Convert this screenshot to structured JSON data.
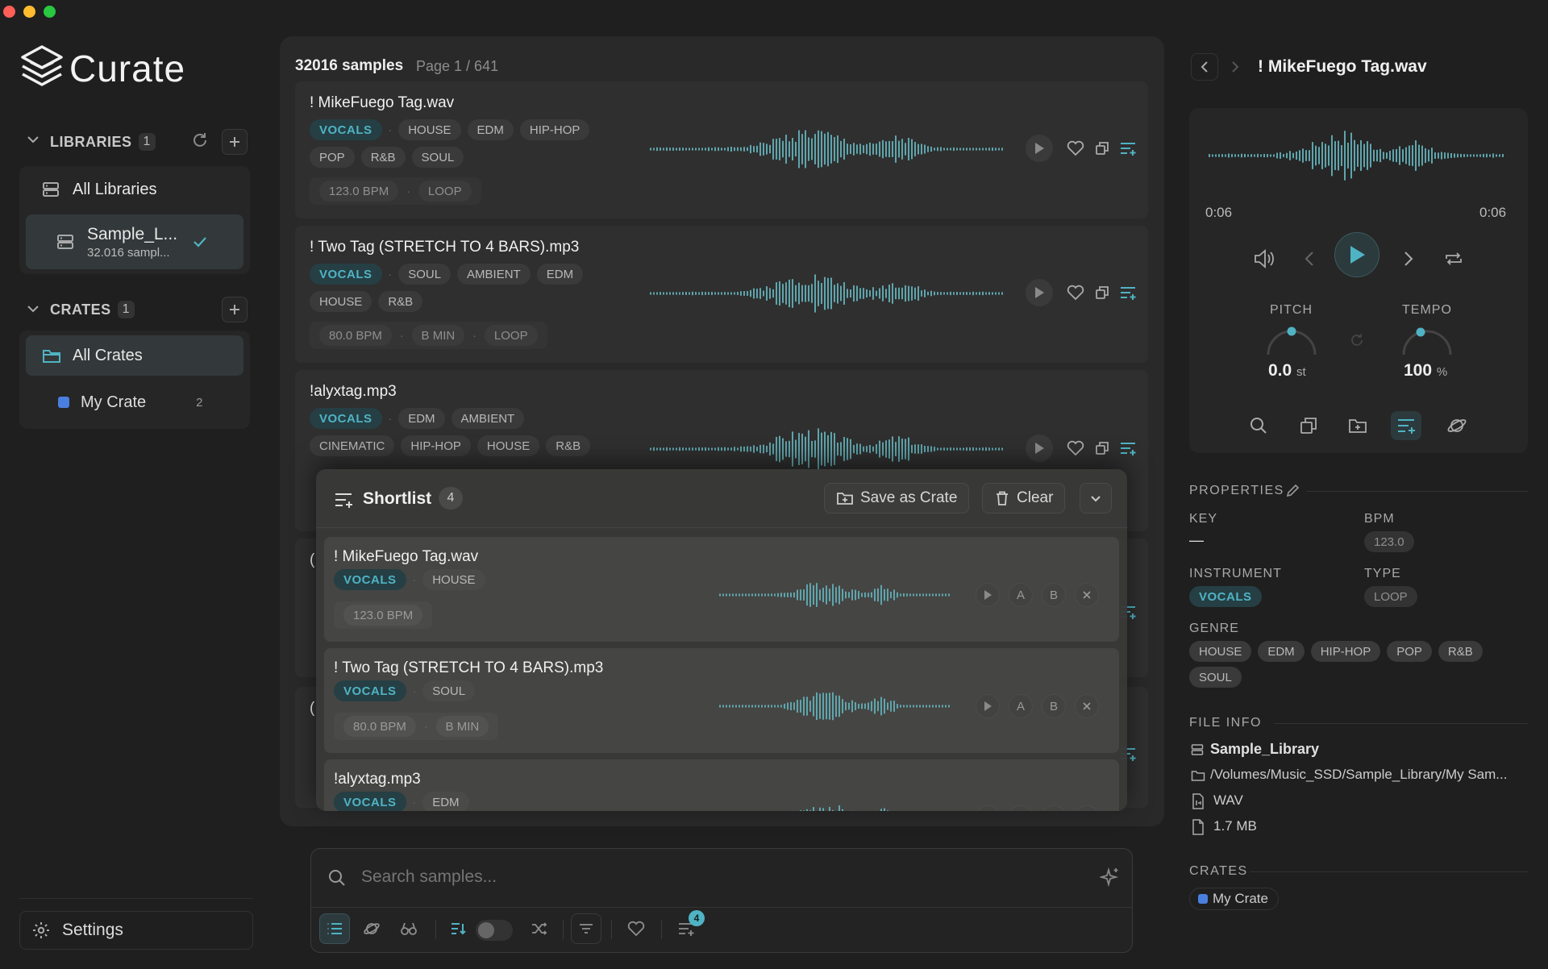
{
  "app": {
    "name": "Curate"
  },
  "sidebar": {
    "libraries_label": "LIBRARIES",
    "libraries_count": "1",
    "all_libraries": "All Libraries",
    "library_name": "Sample_L...",
    "library_sub": "32.016 sampl...",
    "crates_label": "CRATES",
    "crates_count": "1",
    "all_crates": "All Crates",
    "crate_name": "My Crate",
    "crate_count": "2",
    "crate_color": "#4a7fe0",
    "settings": "Settings"
  },
  "results": {
    "count": "32016 samples",
    "page": "Page 1 / 641",
    "items": [
      {
        "name": "! MikeFuego Tag.wav",
        "instrument": "VOCALS",
        "genres1": [
          "HOUSE",
          "EDM",
          "HIP-HOP"
        ],
        "genres2": [
          "POP",
          "R&B",
          "SOUL"
        ],
        "meta": [
          "123.0 BPM",
          "LOOP"
        ]
      },
      {
        "name": "! Two Tag (STRETCH TO 4 BARS).mp3",
        "instrument": "VOCALS",
        "genres1": [
          "SOUL",
          "AMBIENT",
          "EDM"
        ],
        "genres2": [
          "HOUSE",
          "R&B"
        ],
        "meta": [
          "80.0 BPM",
          "B MIN",
          "LOOP"
        ]
      },
      {
        "name": "!alyxtag.mp3",
        "instrument": "VOCALS",
        "genres1": [
          "EDM",
          "AMBIENT"
        ],
        "genres2": [
          "CINEMATIC",
          "HIP-HOP",
          "HOUSE",
          "R&B"
        ],
        "meta": []
      }
    ],
    "partial_letters": [
      "(",
      "("
    ]
  },
  "shortlist": {
    "title": "Shortlist",
    "count": "4",
    "save_label": "Save as Crate",
    "clear_label": "Clear",
    "items": [
      {
        "name": "! MikeFuego Tag.wav",
        "instrument": "VOCALS",
        "genre": "HOUSE",
        "meta": [
          "123.0 BPM"
        ]
      },
      {
        "name": "! Two Tag (STRETCH TO 4 BARS).mp3",
        "instrument": "VOCALS",
        "genre": "SOUL",
        "meta": [
          "80.0 BPM",
          "B MIN"
        ]
      },
      {
        "name": "!alyxtag.mp3",
        "instrument": "VOCALS",
        "genre": "EDM",
        "meta": []
      }
    ],
    "ab_a": "A",
    "ab_b": "B"
  },
  "search": {
    "placeholder": "Search samples...",
    "shortlist_badge": "4"
  },
  "detail": {
    "title": "! MikeFuego Tag.wav",
    "time_start": "0:06",
    "time_end": "0:06",
    "pitch_label": "PITCH",
    "pitch_value": "0.0",
    "pitch_unit": "st",
    "tempo_label": "TEMPO",
    "tempo_value": "100",
    "tempo_unit": "%",
    "properties_label": "PROPERTIES",
    "key_label": "KEY",
    "key_value": "—",
    "bpm_label": "BPM",
    "bpm_value": "123.0",
    "instrument_label": "INSTRUMENT",
    "instrument_value": "VOCALS",
    "type_label": "TYPE",
    "type_value": "LOOP",
    "genre_label": "GENRE",
    "genres": [
      "HOUSE",
      "EDM",
      "HIP-HOP",
      "POP",
      "R&B",
      "SOUL"
    ],
    "file_info_label": "FILE INFO",
    "library": "Sample_Library",
    "path": "/Volumes/Music_SSD/Sample_Library/My Sam...",
    "format": "WAV",
    "size": "1.7 MB",
    "crates_label": "CRATES",
    "crate": "My Crate"
  },
  "colors": {
    "accent": "#4fb3c4",
    "wave": "#5fa5ad",
    "bg": "#1f1f1f"
  }
}
